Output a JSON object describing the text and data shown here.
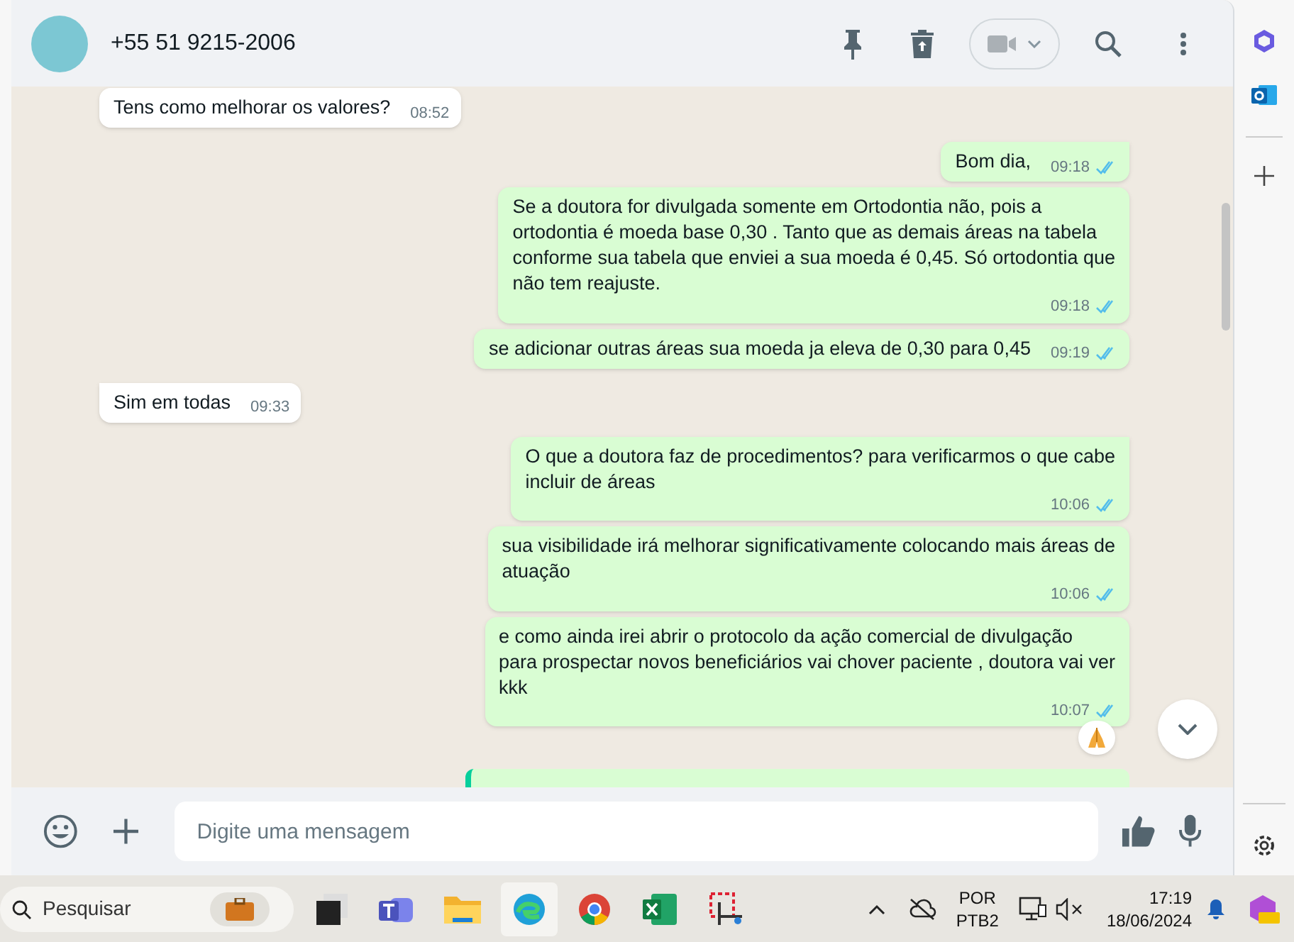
{
  "chat_header": {
    "contact": "+55 51 9215-2006"
  },
  "messages": [
    {
      "kind": "incoming",
      "lines": [
        "Tens como melhorar os valores?"
      ],
      "time": "08:52",
      "tail": false
    },
    {
      "kind": "outgoing",
      "lines": [
        "Bom dia,"
      ],
      "time": "09:18",
      "read": true,
      "tail": true
    },
    {
      "kind": "outgoing",
      "lines": [
        "Se a doutora for divulgada somente em Ortodontia não, pois a",
        "ortodontia é moeda base 0,30 . Tanto que as demais áreas na tabela",
        "conforme sua tabela que enviei a sua moeda é 0,45. Só ortodontia que",
        "não tem reajuste."
      ],
      "time": "09:18",
      "read": true,
      "tail": false
    },
    {
      "kind": "outgoing",
      "lines": [
        "se adicionar outras áreas sua moeda ja eleva de 0,30 para 0,45"
      ],
      "time": "09:19",
      "read": true,
      "tail": false
    },
    {
      "kind": "incoming",
      "lines": [
        "Sim em todas"
      ],
      "time": "09:33",
      "tail": true
    },
    {
      "kind": "outgoing",
      "lines": [
        "O que a doutora faz de procedimentos? para verificarmos o que cabe",
        "incluir de áreas"
      ],
      "time": "10:06",
      "read": true,
      "tail": true
    },
    {
      "kind": "outgoing",
      "lines": [
        "sua visibilidade irá melhorar significativamente colocando mais áreas de",
        "atuação"
      ],
      "time": "10:06",
      "read": true,
      "tail": false
    },
    {
      "kind": "outgoing",
      "lines": [
        "e como ainda irei abrir o protocolo da ação comercial de divulgação",
        "para prospectar novos beneficiários vai chover paciente , doutora vai ver",
        "kkk"
      ],
      "time": "10:07",
      "read": true,
      "tail": false,
      "reaction": true
    }
  ],
  "composer": {
    "placeholder": "Digite uma mensagem"
  },
  "taskbar": {
    "search_placeholder": "Pesquisar",
    "language": "POR",
    "layout": "PTB2",
    "time": "17:19",
    "date": "18/06/2024"
  }
}
